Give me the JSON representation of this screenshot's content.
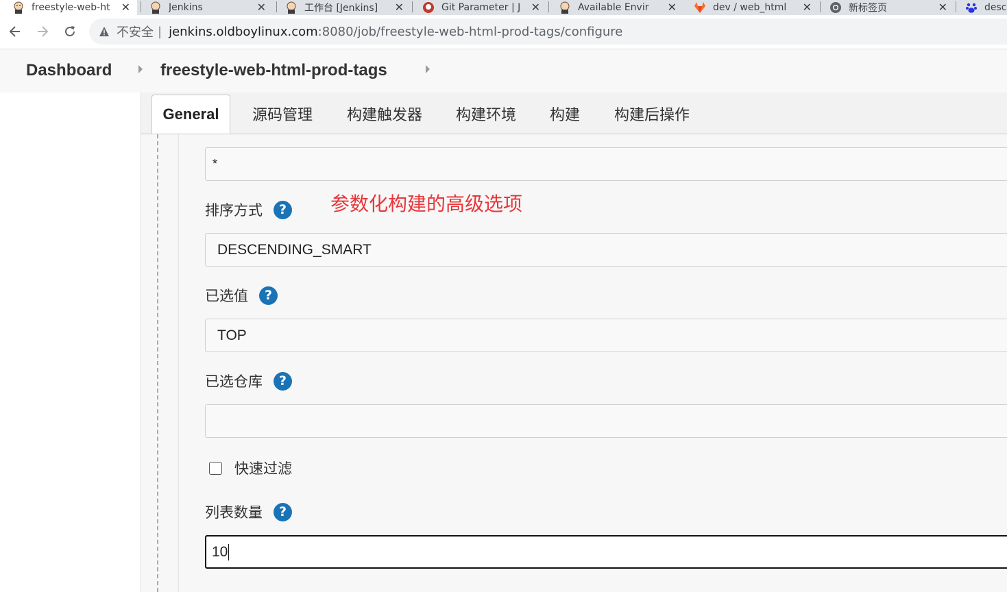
{
  "browser": {
    "tabs": [
      {
        "title": "freestyle-web-ht",
        "active": true,
        "icon": "jenkins-icon"
      },
      {
        "title": "Jenkins",
        "active": false,
        "icon": "jenkins-icon"
      },
      {
        "title": "工作台 [Jenkins]",
        "active": false,
        "icon": "jenkins-icon"
      },
      {
        "title": "Git Parameter | J",
        "active": false,
        "icon": "git-parameter-icon"
      },
      {
        "title": "Available Envir",
        "active": false,
        "icon": "jenkins-icon"
      },
      {
        "title": "dev / web_html",
        "active": false,
        "icon": "gitlab-icon"
      },
      {
        "title": "新标签页",
        "active": false,
        "icon": "chrome-icon"
      },
      {
        "title": "desc",
        "active": false,
        "icon": "baidu-icon"
      }
    ],
    "address_bar": {
      "security_label": "不安全",
      "host": "jenkins.oldboylinux.com",
      "path": ":8080/job/freestyle-web-html-prod-tags/configure"
    }
  },
  "breadcrumb": {
    "dashboard": "Dashboard",
    "job": "freestyle-web-html-prod-tags"
  },
  "config_tabs": [
    "General",
    "源码管理",
    "构建触发器",
    "构建环境",
    "构建",
    "构建后操作"
  ],
  "form": {
    "branch_filter_value": "*",
    "sort_mode_label": "排序方式",
    "sort_mode_value": "DESCENDING_SMART",
    "selected_value_label": "已选值",
    "selected_value_value": "TOP",
    "selected_repo_label": "已选仓库",
    "selected_repo_value": "",
    "quick_filter_label": "快速过滤",
    "quick_filter_checked": false,
    "list_size_label": "列表数量",
    "list_size_value": "10",
    "help_glyph": "?"
  },
  "annotation_text": "参数化构建的高级选项",
  "colors": {
    "help_icon": "#1a73b5",
    "annotation": "#e8363a"
  }
}
